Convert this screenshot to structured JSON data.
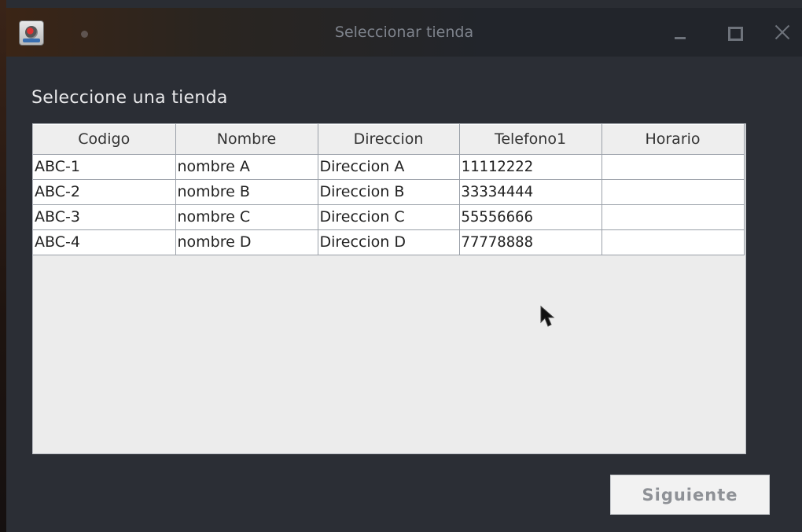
{
  "window": {
    "title": "Seleccionar tienda"
  },
  "main": {
    "heading": "Seleccione una tienda",
    "table": {
      "columns": [
        "Codigo",
        "Nombre",
        "Direccion",
        "Telefono1",
        "Horario"
      ],
      "rows": [
        [
          "ABC-1",
          "nombre A",
          "Direccion A",
          "11112222",
          ""
        ],
        [
          "ABC-2",
          "nombre B",
          "Direccion B",
          "33334444",
          ""
        ],
        [
          "ABC-3",
          "nombre C",
          "Direccion C",
          "55556666",
          ""
        ],
        [
          "ABC-4",
          "nombre D",
          "Direccion D",
          "77778888",
          ""
        ]
      ]
    },
    "next_button_label": "Siguiente"
  },
  "icons": {
    "app": "java-app-icon",
    "sticky": "sticky-dot-icon",
    "minimize": "minimize-icon",
    "maximize": "maximize-icon",
    "close": "close-icon",
    "pointer": "mouse-pointer-icon"
  },
  "colors": {
    "window_bg": "#2b2e35",
    "table_bg": "#ececec",
    "button_text_disabled": "#8e9196"
  }
}
